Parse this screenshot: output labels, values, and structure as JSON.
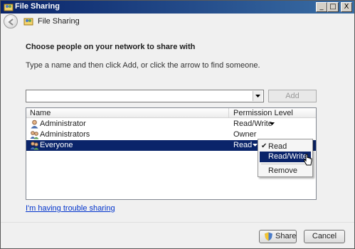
{
  "window": {
    "title": "File Sharing",
    "controls": {
      "minimize": "_",
      "maximize": "□",
      "close": "X"
    }
  },
  "nav": {
    "title": "File Sharing"
  },
  "heading": "Choose people on your network to share with",
  "instructions": "Type a name and then click Add, or click the arrow to find someone.",
  "input": {
    "value": ""
  },
  "add_label": "Add",
  "list": {
    "headers": {
      "name": "Name",
      "permission": "Permission Level"
    },
    "rows": [
      {
        "name": "Administrator",
        "permission": "Read/Write",
        "icon": "user-icon",
        "selected": false
      },
      {
        "name": "Administrators",
        "permission": "Owner",
        "icon": "group-icon",
        "selected": false
      },
      {
        "name": "Everyone",
        "permission": "Read",
        "icon": "group-icon",
        "selected": true
      }
    ]
  },
  "menu": {
    "items": [
      {
        "label": "Read",
        "checked": true
      },
      {
        "label": "Read/Write",
        "checked": false,
        "highlighted": true
      },
      {
        "label": "Remove",
        "checked": false
      }
    ],
    "check_glyph": "✔"
  },
  "trouble_link": "I'm having trouble sharing",
  "buttons": {
    "share": "Share",
    "cancel": "Cancel"
  },
  "colors": {
    "selection": "#0a246a",
    "link": "#0033cc",
    "title_bar": "#0a246a"
  }
}
